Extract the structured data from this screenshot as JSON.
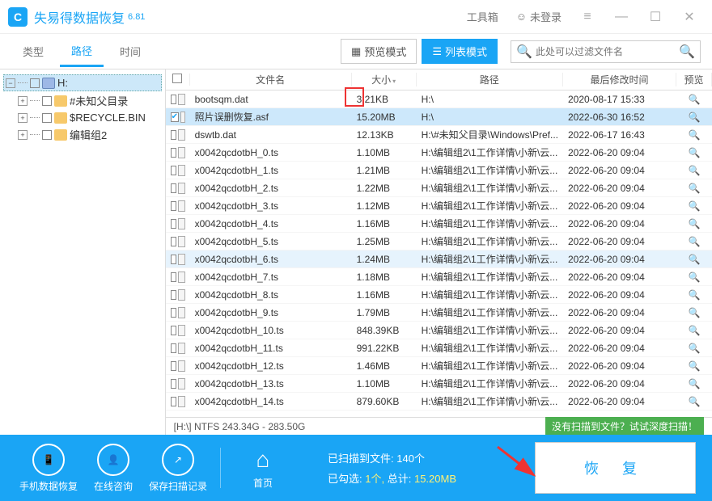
{
  "header": {
    "logo_text": "C",
    "title": "失易得数据恢复",
    "version": "6.81",
    "toolbox": "工具箱",
    "login": "未登录"
  },
  "tabs": {
    "type": "类型",
    "path": "路径",
    "time": "时间"
  },
  "modes": {
    "preview": "预览模式",
    "list": "列表模式"
  },
  "search": {
    "placeholder": "此处可以过滤文件名"
  },
  "tree": {
    "root": "H:",
    "items": [
      "#未知父目录",
      "$RECYCLE.BIN",
      "编辑组2"
    ]
  },
  "columns": {
    "name": "文件名",
    "size": "大小",
    "path": "路径",
    "date": "最后修改时间",
    "preview": "预览"
  },
  "rows": [
    {
      "name": "bootsqm.dat",
      "size": "3.21KB",
      "path": "H:\\",
      "date": "2020-08-17  15:33",
      "checked": false,
      "sel": false
    },
    {
      "name": "照片误删恢复.asf",
      "size": "15.20MB",
      "path": "H:\\",
      "date": "2022-06-30  16:52",
      "checked": true,
      "sel": true
    },
    {
      "name": "dswtb.dat",
      "size": "12.13KB",
      "path": "H:\\#未知父目录\\Windows\\Pref...",
      "date": "2022-06-17  16:43",
      "checked": false,
      "sel": false
    },
    {
      "name": "x0042qcdotbH_0.ts",
      "size": "1.10MB",
      "path": "H:\\编辑组2\\1工作详情\\小新\\云...",
      "date": "2022-06-20  09:04",
      "checked": false,
      "sel": false
    },
    {
      "name": "x0042qcdotbH_1.ts",
      "size": "1.21MB",
      "path": "H:\\编辑组2\\1工作详情\\小新\\云...",
      "date": "2022-06-20  09:04",
      "checked": false,
      "sel": false
    },
    {
      "name": "x0042qcdotbH_2.ts",
      "size": "1.22MB",
      "path": "H:\\编辑组2\\1工作详情\\小新\\云...",
      "date": "2022-06-20  09:04",
      "checked": false,
      "sel": false
    },
    {
      "name": "x0042qcdotbH_3.ts",
      "size": "1.12MB",
      "path": "H:\\编辑组2\\1工作详情\\小新\\云...",
      "date": "2022-06-20  09:04",
      "checked": false,
      "sel": false
    },
    {
      "name": "x0042qcdotbH_4.ts",
      "size": "1.16MB",
      "path": "H:\\编辑组2\\1工作详情\\小新\\云...",
      "date": "2022-06-20  09:04",
      "checked": false,
      "sel": false
    },
    {
      "name": "x0042qcdotbH_5.ts",
      "size": "1.25MB",
      "path": "H:\\编辑组2\\1工作详情\\小新\\云...",
      "date": "2022-06-20  09:04",
      "checked": false,
      "sel": false
    },
    {
      "name": "x0042qcdotbH_6.ts",
      "size": "1.24MB",
      "path": "H:\\编辑组2\\1工作详情\\小新\\云...",
      "date": "2022-06-20  09:04",
      "checked": false,
      "hl": true
    },
    {
      "name": "x0042qcdotbH_7.ts",
      "size": "1.18MB",
      "path": "H:\\编辑组2\\1工作详情\\小新\\云...",
      "date": "2022-06-20  09:04",
      "checked": false,
      "sel": false
    },
    {
      "name": "x0042qcdotbH_8.ts",
      "size": "1.16MB",
      "path": "H:\\编辑组2\\1工作详情\\小新\\云...",
      "date": "2022-06-20  09:04",
      "checked": false,
      "sel": false
    },
    {
      "name": "x0042qcdotbH_9.ts",
      "size": "1.79MB",
      "path": "H:\\编辑组2\\1工作详情\\小新\\云...",
      "date": "2022-06-20  09:04",
      "checked": false,
      "sel": false
    },
    {
      "name": "x0042qcdotbH_10.ts",
      "size": "848.39KB",
      "path": "H:\\编辑组2\\1工作详情\\小新\\云...",
      "date": "2022-06-20  09:04",
      "checked": false,
      "sel": false
    },
    {
      "name": "x0042qcdotbH_11.ts",
      "size": "991.22KB",
      "path": "H:\\编辑组2\\1工作详情\\小新\\云...",
      "date": "2022-06-20  09:04",
      "checked": false,
      "sel": false
    },
    {
      "name": "x0042qcdotbH_12.ts",
      "size": "1.46MB",
      "path": "H:\\编辑组2\\1工作详情\\小新\\云...",
      "date": "2022-06-20  09:04",
      "checked": false,
      "sel": false
    },
    {
      "name": "x0042qcdotbH_13.ts",
      "size": "1.10MB",
      "path": "H:\\编辑组2\\1工作详情\\小新\\云...",
      "date": "2022-06-20  09:04",
      "checked": false,
      "sel": false
    },
    {
      "name": "x0042qcdotbH_14.ts",
      "size": "879.60KB",
      "path": "H:\\编辑组2\\1工作详情\\小新\\云...",
      "date": "2022-06-20  09:04",
      "checked": false,
      "sel": false
    }
  ],
  "status": {
    "disk": "[H:\\] NTFS 243.34G - 283.50G",
    "deep_scan": "没有扫描到文件？试试深度扫描！"
  },
  "footer": {
    "phone": "手机数据恢复",
    "consult": "在线咨询",
    "save": "保存扫描记录",
    "home": "首页",
    "scanned_label": "已扫描到文件:",
    "scanned_count": "140个",
    "selected_label": "已勾选:",
    "selected_count": "1个,",
    "total_label": "总计:",
    "total_size": "15.20MB",
    "recover": "恢 复"
  }
}
